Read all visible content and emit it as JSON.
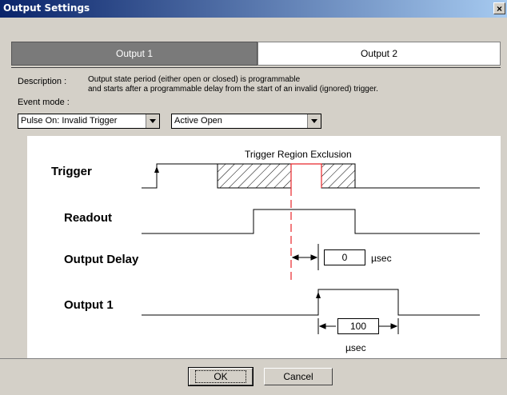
{
  "window": {
    "title": "Output Settings",
    "close_symbol": "×"
  },
  "tabs": [
    {
      "label": "Output 1",
      "selected": true
    },
    {
      "label": "Output 2",
      "selected": false
    }
  ],
  "description": {
    "label": "Description :",
    "line1": "Output state period (either open or closed) is programmable",
    "line2": "and starts after a programmable delay from the start of an invalid (ignored) trigger."
  },
  "event_mode": {
    "label": "Event mode :",
    "trigger_select": "Pulse On: Invalid Trigger",
    "state_select": "Active Open"
  },
  "diagram": {
    "trigger_label": "Trigger",
    "readout_label": "Readout",
    "delay_label": "Output Delay",
    "output_label": "Output 1",
    "region_label": "Trigger Region Exclusion",
    "delay_value": "0",
    "delay_unit": "µsec",
    "width_value": "100",
    "width_unit": "µsec"
  },
  "buttons": {
    "ok": "OK",
    "cancel": "Cancel"
  },
  "colors": {
    "titlebar_start": "#0a246a",
    "titlebar_end": "#a6caf0",
    "marker_red": "#e8262a"
  }
}
